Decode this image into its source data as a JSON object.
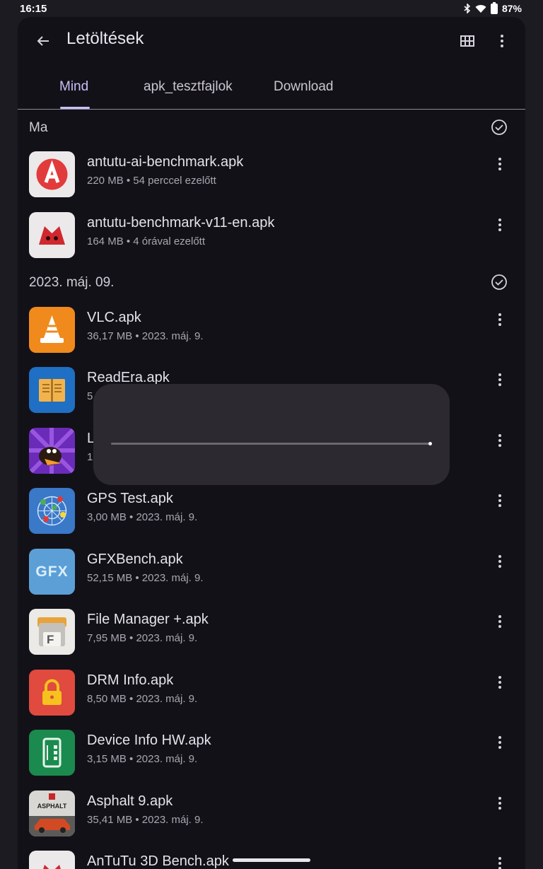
{
  "status_bar": {
    "time": "16:15",
    "battery": "87%"
  },
  "header": {
    "title": "Letöltések"
  },
  "tabs": [
    {
      "label": "Mind",
      "active": true
    },
    {
      "label": "apk_tesztfajlok",
      "active": false
    },
    {
      "label": "Download",
      "active": false
    }
  ],
  "sections": [
    {
      "label": "Ma",
      "files": [
        {
          "name": "antutu-ai-benchmark.apk",
          "meta": "220 MB • 54 perccel ezelőtt",
          "icon": "antutu-ai-icon"
        },
        {
          "name": "antutu-benchmark-v11-en.apk",
          "meta": "164 MB • 4 órával ezelőtt",
          "icon": "antutu-icon"
        }
      ]
    },
    {
      "label": "2023. máj. 09.",
      "files": [
        {
          "name": "VLC.apk",
          "meta": "36,17 MB • 2023. máj. 9.",
          "icon": "vlc-icon"
        },
        {
          "name": "ReadEra.apk",
          "meta": "5",
          "icon": "readera-icon"
        },
        {
          "name": "L",
          "meta": "12",
          "icon": "game-icon"
        },
        {
          "name": "GPS Test.apk",
          "meta": "3,00 MB • 2023. máj. 9.",
          "icon": "gps-test-icon"
        },
        {
          "name": "GFXBench.apk",
          "meta": "52,15 MB • 2023. máj. 9.",
          "icon": "gfxbench-icon",
          "icon_text": "GFX"
        },
        {
          "name": "File Manager +.apk",
          "meta": "7,95 MB • 2023. máj. 9.",
          "icon": "file-manager-icon",
          "icon_text": "F"
        },
        {
          "name": "DRM Info.apk",
          "meta": "8,50 MB • 2023. máj. 9.",
          "icon": "lock-icon"
        },
        {
          "name": "Device Info HW.apk",
          "meta": "3,15 MB • 2023. máj. 9.",
          "icon": "device-info-icon"
        },
        {
          "name": "Asphalt 9.apk",
          "meta": "35,41 MB • 2023. máj. 9.",
          "icon": "asphalt-icon",
          "icon_text": "ASPHALT"
        },
        {
          "name": "AnTuTu 3D Bench.apk",
          "meta": "",
          "icon": "antutu-3d-icon"
        }
      ]
    }
  ],
  "progress_dialog": {
    "progress": 0.99
  },
  "colors": {
    "accent": "#c8bff5",
    "background": "#131118",
    "dialog": "#2c2a30"
  }
}
